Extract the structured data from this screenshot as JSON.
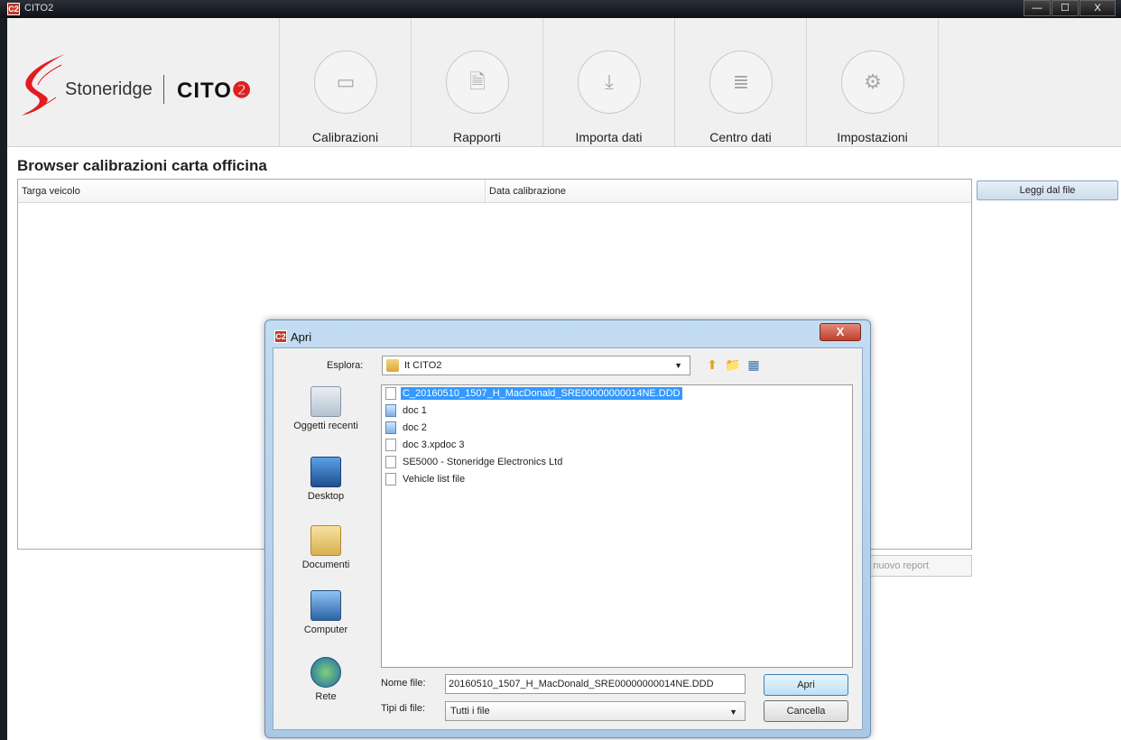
{
  "window": {
    "title": "CITO2",
    "app_icon": "C2",
    "minimize": "—",
    "maximize": "☐",
    "close": "X"
  },
  "header": {
    "brand": "Stoneridge",
    "product": "CITO",
    "product_suffix": "❷",
    "nav": [
      {
        "label": "Calibrazioni",
        "icon": "card-icon"
      },
      {
        "label": "Rapporti",
        "icon": "document-icon"
      },
      {
        "label": "Importa dati",
        "icon": "download-icon"
      },
      {
        "label": "Centro dati",
        "icon": "database-icon"
      },
      {
        "label": "Impostazioni",
        "icon": "gear-icon"
      }
    ]
  },
  "main": {
    "title": "Browser calibrazioni carta officina",
    "columns": [
      "Targa veicolo",
      "Data calibrazione"
    ],
    "read_button": "Leggi dal file",
    "new_report_button": "me nuovo report"
  },
  "dialog": {
    "title": "Apri",
    "close": "X",
    "look_in_label": "Esplora:",
    "look_in_value": "It CITO2",
    "places": [
      "Oggetti recenti",
      "Desktop",
      "Documenti",
      "Computer",
      "Rete"
    ],
    "files": [
      {
        "name": "C_20160510_1507_H_MacDonald_SRE00000000014NE.DDD",
        "type": "file",
        "selected": true
      },
      {
        "name": "doc 1",
        "type": "image",
        "selected": false
      },
      {
        "name": "doc 2",
        "type": "image",
        "selected": false
      },
      {
        "name": "doc 3.xpdoc 3",
        "type": "file",
        "selected": false
      },
      {
        "name": "SE5000 - Stoneridge Electronics Ltd",
        "type": "file",
        "selected": false
      },
      {
        "name": "Vehicle list file",
        "type": "file",
        "selected": false
      }
    ],
    "file_name_label": "Nome file:",
    "file_name_value": "20160510_1507_H_MacDonald_SRE00000000014NE.DDD",
    "file_type_label": "Tipi di file:",
    "file_type_value": "Tutti i file",
    "open_button": "Apri",
    "cancel_button": "Cancella"
  }
}
